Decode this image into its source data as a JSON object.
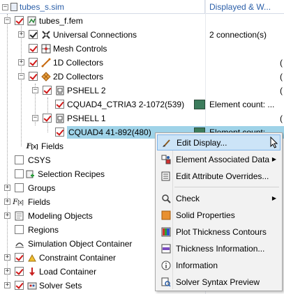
{
  "header": {
    "col1_title": "tubes_s.sim",
    "col2_title": "Displayed & W..."
  },
  "tree": {
    "nodes": [
      {
        "label": "tubes_f.fem",
        "value": ""
      },
      {
        "label": "Universal Connections",
        "value": "2 connection(s)"
      },
      {
        "label": "Mesh Controls",
        "value": ""
      },
      {
        "label": "1D Collectors",
        "value": "("
      },
      {
        "label": "2D Collectors",
        "value": "("
      },
      {
        "label": "PSHELL 2",
        "value": "("
      },
      {
        "label": "CQUAD4_CTRIA3 2-1072(539)",
        "value": "Element count: ..."
      },
      {
        "label": "PSHELL 1",
        "value": "("
      },
      {
        "label": "CQUAD4 41-892(480)",
        "value": "Element count: ..."
      },
      {
        "label": "Fields",
        "value": ""
      },
      {
        "label": "CSYS",
        "value": ""
      },
      {
        "label": "Selection Recipes",
        "value": ""
      },
      {
        "label": "Groups",
        "value": ""
      },
      {
        "label": "Fields",
        "value": ""
      },
      {
        "label": "Modeling Objects",
        "value": ""
      },
      {
        "label": "Regions",
        "value": ""
      },
      {
        "label": "Simulation Object Container",
        "value": ""
      },
      {
        "label": "Constraint Container",
        "value": ""
      },
      {
        "label": "Load Container",
        "value": ""
      },
      {
        "label": "Solver Sets",
        "value": ""
      }
    ]
  },
  "context_menu": {
    "items": [
      {
        "label": "Edit Display...",
        "icon": "brush-icon"
      },
      {
        "label": "Element Associated Data",
        "icon": "element-data-icon"
      },
      {
        "label": "Edit Attribute Overrides...",
        "icon": "attribute-overrides-icon"
      },
      {
        "label": "Check",
        "icon": "check-icon"
      },
      {
        "label": "Solid Properties",
        "icon": "solid-properties-icon"
      },
      {
        "label": "Plot Thickness Contours",
        "icon": "thickness-contours-icon"
      },
      {
        "label": "Thickness Information...",
        "icon": "thickness-info-icon"
      },
      {
        "label": "Information",
        "icon": "info-icon"
      },
      {
        "label": "Solver Syntax Preview",
        "icon": "syntax-preview-icon"
      }
    ]
  },
  "colors": {
    "header_text": "#2a5ea8",
    "selection": "#9fd3e8",
    "menu_highlight": "#cce4f7",
    "checkmark": "#d01818",
    "swatch": "#3c7c5c"
  }
}
